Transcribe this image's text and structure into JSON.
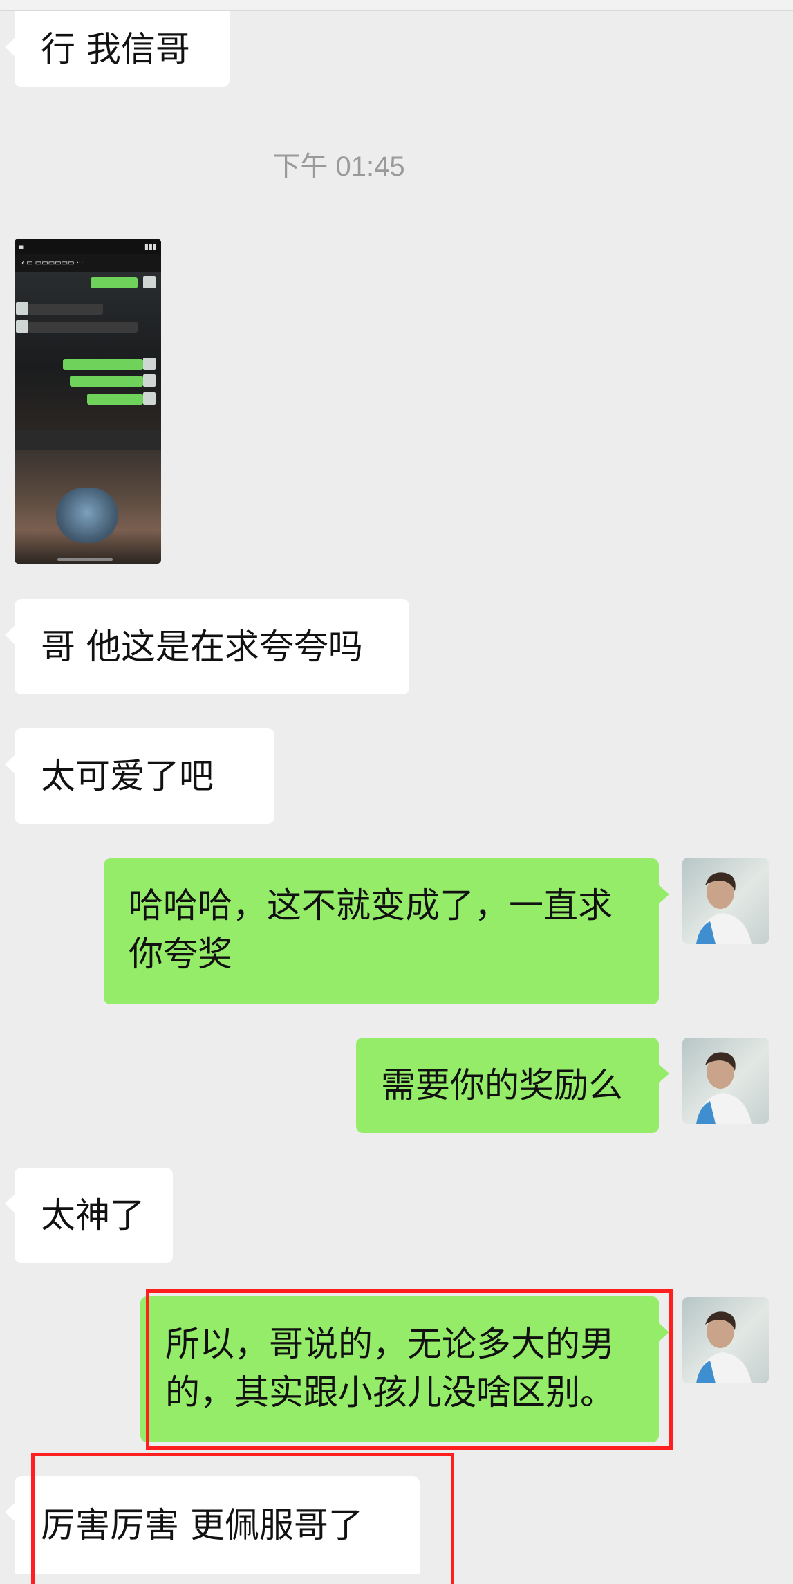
{
  "chat": {
    "timestamp": "下午 01:45",
    "messages": [
      {
        "id": "m1",
        "side": "in",
        "text": "行  我信哥"
      },
      {
        "id": "m2",
        "side": "in",
        "type": "image",
        "alt": "screenshot"
      },
      {
        "id": "m3",
        "side": "in",
        "text": "哥  他这是在求夸夸吗"
      },
      {
        "id": "m4",
        "side": "in",
        "text": "太可爱了吧"
      },
      {
        "id": "m5",
        "side": "out",
        "lines": [
          "哈哈哈，这不就变成了，一直求",
          "你夸奖"
        ]
      },
      {
        "id": "m6",
        "side": "out",
        "text": "需要你的奖励么"
      },
      {
        "id": "m7",
        "side": "in",
        "text": "太神了"
      },
      {
        "id": "m8",
        "side": "out",
        "lines": [
          "所以，哥说的，无论多大的男",
          "的，其实跟小孩儿没啥区别。"
        ],
        "highlighted": true
      },
      {
        "id": "m9",
        "side": "in",
        "text": "厉害厉害   更佩服哥了",
        "highlighted": true
      }
    ]
  },
  "colors": {
    "background": "#ededed",
    "incoming_bubble": "#ffffff",
    "outgoing_bubble": "#95ec69",
    "highlight": "#ff1f1f",
    "timestamp": "#9a9a9a"
  }
}
